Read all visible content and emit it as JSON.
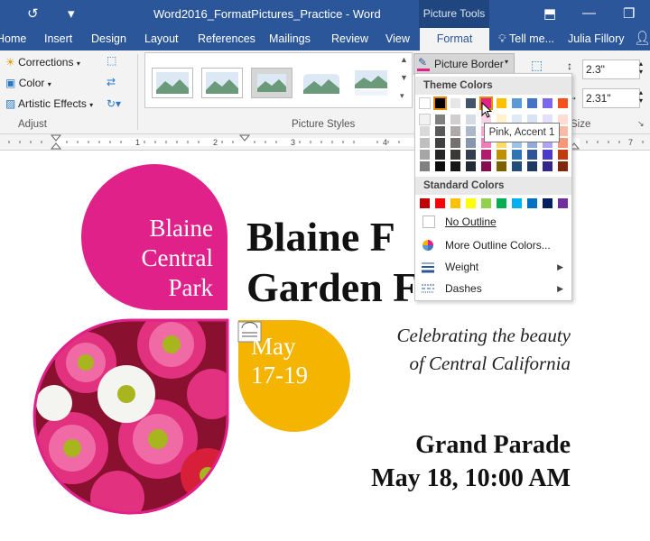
{
  "window": {
    "title": "Word2016_FormatPictures_Practice - Word",
    "context_tab": "Picture Tools"
  },
  "tabs": [
    {
      "label": "Home"
    },
    {
      "label": "Insert"
    },
    {
      "label": "Design"
    },
    {
      "label": "Layout"
    },
    {
      "label": "References"
    },
    {
      "label": "Mailings"
    },
    {
      "label": "Review"
    },
    {
      "label": "View"
    },
    {
      "label": "Format"
    }
  ],
  "tell_me": "Tell me...",
  "user": "Julia Fillory",
  "ribbon": {
    "adjust": {
      "corrections": "Corrections",
      "color": "Color",
      "artistic": "Artistic Effects",
      "label": "Adjust"
    },
    "styles": {
      "label": "Picture Styles"
    },
    "picture_border": "Picture Border",
    "size": {
      "height": "2.3\"",
      "width": "2.31\"",
      "label": "Size"
    }
  },
  "menu": {
    "theme_header": "Theme Colors",
    "standard_header": "Standard Colors",
    "no_outline": "No Outline",
    "more_colors": "More Outline Colors...",
    "weight": "Weight",
    "dashes": "Dashes",
    "tooltip": "Pink, Accent 1",
    "theme_columns": [
      [
        "#ffffff",
        "#f2f2f2",
        "#d9d9d9",
        "#bfbfbf",
        "#a6a6a6",
        "#808080"
      ],
      [
        "#000000",
        "#808080",
        "#595959",
        "#404040",
        "#262626",
        "#0d0d0d"
      ],
      [
        "#e7e6e6",
        "#d0cece",
        "#aeaaaa",
        "#757171",
        "#3b3838",
        "#171616"
      ],
      [
        "#44546a",
        "#d6dce4",
        "#adb9ca",
        "#8496b0",
        "#333f4f",
        "#222a35"
      ],
      [
        "#e0218a",
        "#fbd3e9",
        "#f6a7d2",
        "#f27bbc",
        "#b31a6e",
        "#860d4f"
      ],
      [
        "#ffc000",
        "#fff2cc",
        "#ffe699",
        "#ffd966",
        "#bf9000",
        "#7f6000"
      ],
      [
        "#5b9bd5",
        "#deebf6",
        "#bdd7ee",
        "#9dc3e6",
        "#2e75b5",
        "#1f4e79"
      ],
      [
        "#4472c4",
        "#dae3f3",
        "#b4c7e7",
        "#8faadc",
        "#2f5597",
        "#1f3864"
      ],
      [
        "#7b68ee",
        "#e4e0fb",
        "#cac1f8",
        "#afa4f4",
        "#4b3acb",
        "#322787"
      ],
      [
        "#f4511e",
        "#fdddd2",
        "#fbbaa5",
        "#f89878",
        "#c13a10",
        "#80270b"
      ]
    ],
    "standard_colors": [
      "#c00000",
      "#ff0000",
      "#ffc000",
      "#ffff00",
      "#92d050",
      "#00b050",
      "#00b0f0",
      "#0070c0",
      "#002060",
      "#7030a0"
    ]
  },
  "document": {
    "badge": [
      "Blaine",
      "Central",
      "Park"
    ],
    "title_line1": "Blaine F",
    "title_line2": "Garden F",
    "date_line1": "May",
    "date_line2": "17-19",
    "tagline1": "Celebrating the beauty",
    "tagline2": "of Central California",
    "event1": "Grand Parade",
    "event2": "May 18, 10:00 AM"
  },
  "colors": {
    "accent_pink": "#e0218a",
    "accent_yellow": "#f4b400",
    "word_blue": "#2b579a"
  }
}
